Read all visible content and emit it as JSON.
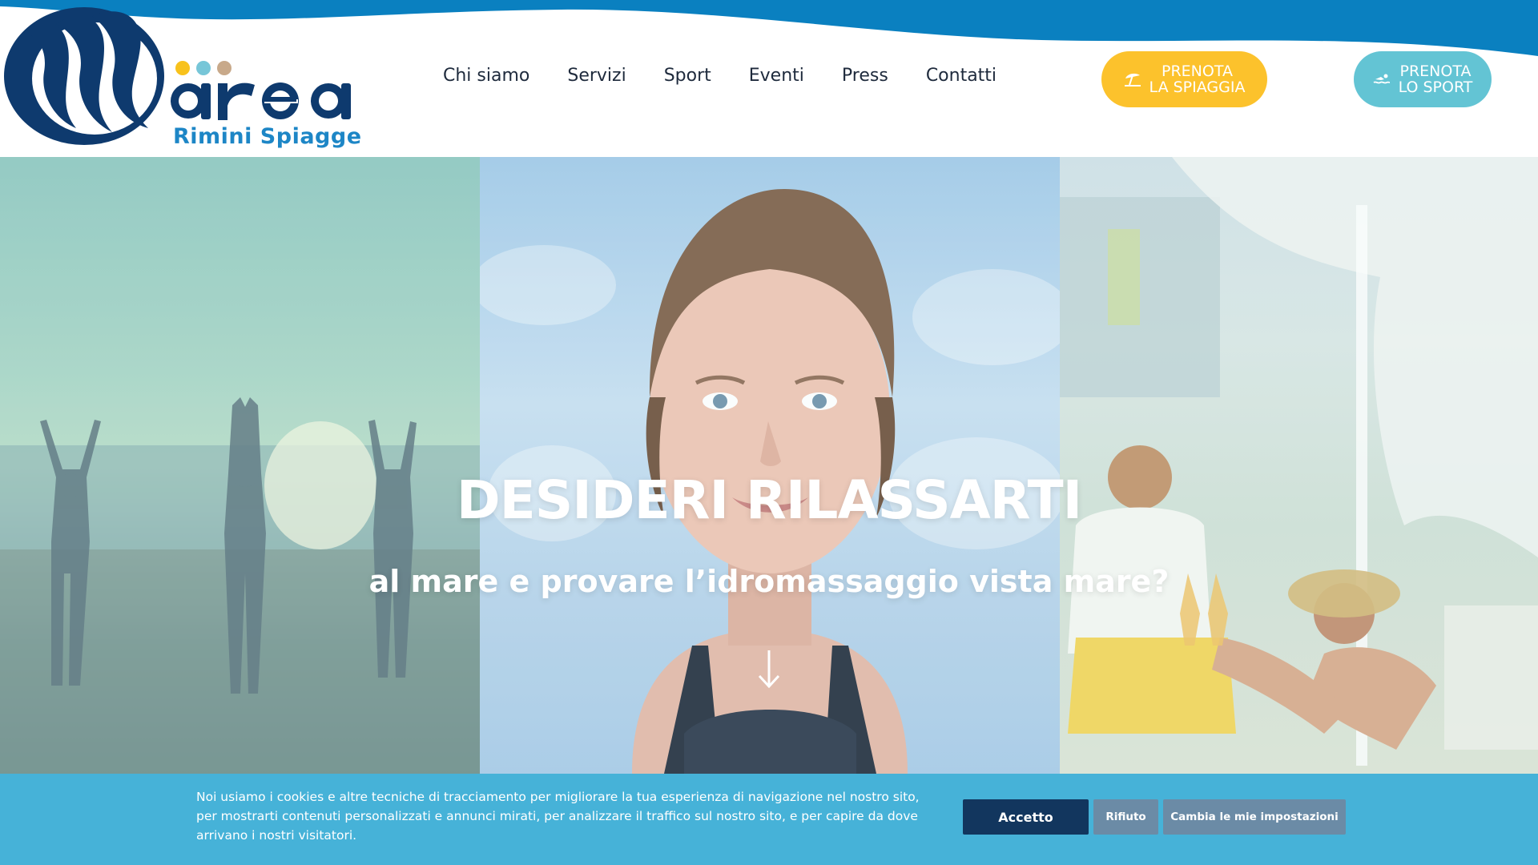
{
  "brand": {
    "logo_text": "area",
    "subtitle": "Rimini Spiagge",
    "colors": {
      "navy": "#0e3a6e",
      "blue": "#1d86c6",
      "wave": "#0a80c0",
      "dot_yellow": "#f8c21c",
      "dot_teal": "#77c6d8",
      "dot_tan": "#c8a98a"
    }
  },
  "nav": {
    "items": [
      {
        "label": "Chi siamo"
      },
      {
        "label": "Servizi"
      },
      {
        "label": "Sport"
      },
      {
        "label": "Eventi"
      },
      {
        "label": "Press"
      },
      {
        "label": "Contatti"
      }
    ]
  },
  "cta": {
    "beach": {
      "line1": "PRENOTA",
      "line2": "LA SPIAGGIA",
      "icon": "beach-umbrella-icon",
      "color": "#fcc22c"
    },
    "sport": {
      "line1": "PRENOTA",
      "line2": "LO SPORT",
      "icon": "swimmer-icon",
      "color": "#63c4d4"
    }
  },
  "hero": {
    "title": "DESIDERI RILASSARTI",
    "subtitle": "al mare e provare l’idromassaggio vista mare?",
    "scroll_icon": "arrow-down-icon"
  },
  "cookie": {
    "text": "Noi usiamo i cookies e altre tecniche di tracciamento per migliorare la tua esperienza di navigazione nel nostro sito, per mostrarti contenuti personalizzati e annunci mirati, per analizzare il traffico sul nostro sito, e per capire da dove arrivano i nostri visitatori.",
    "accept_label": "Accetto",
    "reject_label": "Rifiuto",
    "settings_label": "Cambia le mie impostazioni",
    "background": "#46b2d8"
  }
}
